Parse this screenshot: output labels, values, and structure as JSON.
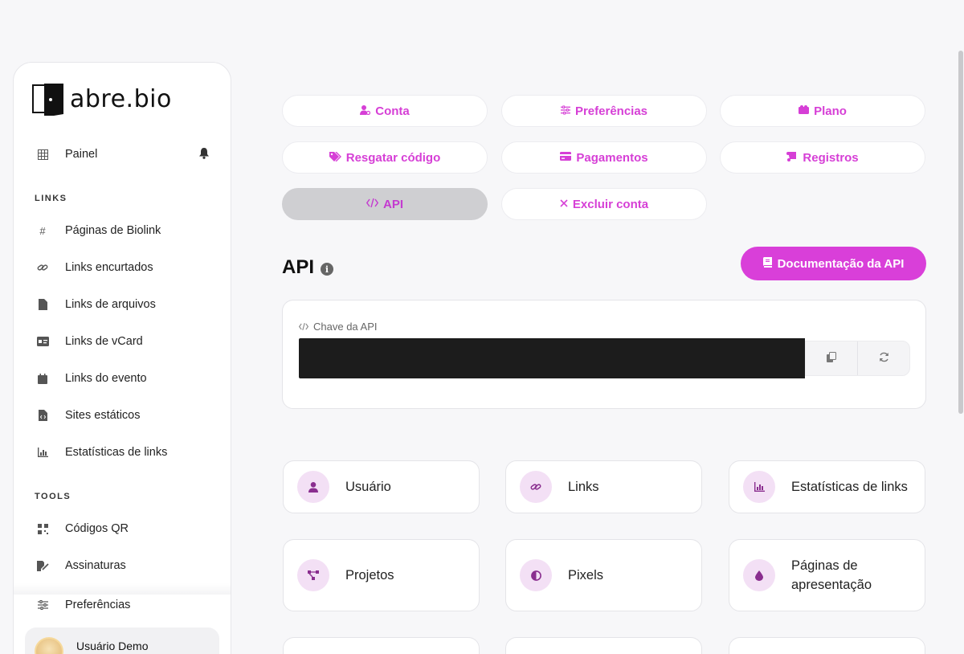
{
  "brand": {
    "name": "abre.bio"
  },
  "sidebar": {
    "dashboard": "Painel",
    "links_section": "LINKS",
    "links": [
      {
        "label": "Páginas de Biolink",
        "icon": "hash-icon"
      },
      {
        "label": "Links encurtados",
        "icon": "link-icon"
      },
      {
        "label": "Links de arquivos",
        "icon": "file-icon"
      },
      {
        "label": "Links de vCard",
        "icon": "id-card-icon"
      },
      {
        "label": "Links do evento",
        "icon": "calendar-icon"
      },
      {
        "label": "Sites estáticos",
        "icon": "file-code-icon"
      },
      {
        "label": "Estatísticas de links",
        "icon": "chart-icon"
      }
    ],
    "tools_section": "TOOLS",
    "tools": [
      {
        "label": "Códigos QR",
        "icon": "qr-icon"
      },
      {
        "label": "Assinaturas",
        "icon": "signature-icon"
      }
    ],
    "preferences": "Preferências",
    "user_name": "Usuário Demo"
  },
  "tabs": [
    {
      "label": "Conta",
      "icon": "user-cog-icon"
    },
    {
      "label": "Preferências",
      "icon": "sliders-icon"
    },
    {
      "label": "Plano",
      "icon": "box-icon"
    },
    {
      "label": "Resgatar código",
      "icon": "tags-icon"
    },
    {
      "label": "Pagamentos",
      "icon": "credit-card-icon"
    },
    {
      "label": "Registros",
      "icon": "scroll-icon"
    },
    {
      "label": "API",
      "icon": "code-icon",
      "active": true
    },
    {
      "label": "Excluir conta",
      "icon": "times-icon"
    }
  ],
  "page": {
    "title": "API",
    "doc_button": "Documentação da API",
    "key_label": "Chave da API"
  },
  "features": [
    {
      "label": "Usuário",
      "icon": "user-icon"
    },
    {
      "label": "Links",
      "icon": "link-icon"
    },
    {
      "label": "Estatísticas de links",
      "icon": "chart-icon"
    },
    {
      "label": "Projetos",
      "icon": "project-diagram-icon"
    },
    {
      "label": "Pixels",
      "icon": "adjust-icon"
    },
    {
      "label": "Páginas de apresentação",
      "icon": "droplet-icon"
    }
  ],
  "colors": {
    "accent": "#d93fd9",
    "accent_soft": "#f3e0f5",
    "active_tab": "#cfcfd2"
  }
}
